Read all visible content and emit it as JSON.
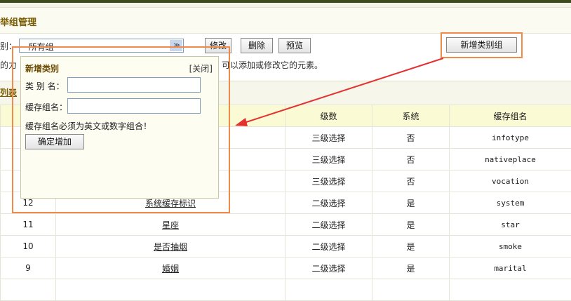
{
  "page": {
    "title": "举组管理"
  },
  "filter": {
    "label": "别：",
    "selected": "--所有组--",
    "arrow": "≫"
  },
  "buttons": {
    "edit": "修改",
    "delete": "删除",
    "preview": "预览",
    "add_group": "新增类别组"
  },
  "hint": {
    "left": "的力",
    "right": "可以添加或修改它的元素。"
  },
  "section": {
    "title": "列表"
  },
  "table": {
    "headers": [
      "",
      "",
      "级数",
      "系统",
      "缓存组名"
    ],
    "rows": [
      [
        "",
        "",
        "三级选择",
        "否",
        "infotype"
      ],
      [
        "",
        "",
        "三级选择",
        "否",
        "nativeplace"
      ],
      [
        "",
        "",
        "三级选择",
        "否",
        "vocation"
      ],
      [
        "12",
        "系统缓存标识",
        "二级选择",
        "是",
        "system"
      ],
      [
        "11",
        "星座",
        "二级选择",
        "是",
        "star"
      ],
      [
        "10",
        "是否抽烟",
        "二级选择",
        "是",
        "smoke"
      ],
      [
        "9",
        "婚姻",
        "二级选择",
        "是",
        "marital"
      ],
      [
        "",
        "",
        "",
        "",
        ""
      ]
    ]
  },
  "popup": {
    "title": "新增类别",
    "close": "[关闭]",
    "name_label": "类 别 名：",
    "name_value": "",
    "cache_label": "缓存组名：",
    "cache_value": "",
    "note": "缓存组名必须为英文或数字组合！",
    "submit": "确定增加"
  },
  "colors": {
    "highlight": "#f08a4b",
    "arrow": "#e53030",
    "header_bg": "#fafad4",
    "title": "#7a5a00"
  }
}
